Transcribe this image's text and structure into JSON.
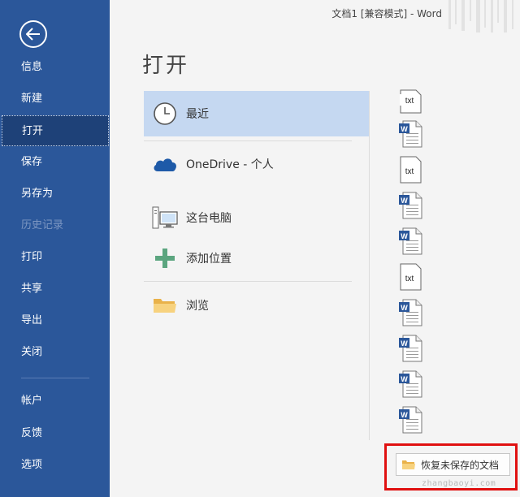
{
  "window": {
    "title": "文档1 [兼容模式]  -  Word"
  },
  "nav": {
    "back_icon": "back-arrow-icon",
    "items": [
      {
        "label": "信息",
        "state": "normal"
      },
      {
        "label": "新建",
        "state": "normal"
      },
      {
        "label": "打开",
        "state": "active"
      },
      {
        "label": "保存",
        "state": "normal"
      },
      {
        "label": "另存为",
        "state": "normal"
      },
      {
        "label": "历史记录",
        "state": "disabled"
      },
      {
        "label": "打印",
        "state": "normal"
      },
      {
        "label": "共享",
        "state": "normal"
      },
      {
        "label": "导出",
        "state": "normal"
      },
      {
        "label": "关闭",
        "state": "normal"
      },
      {
        "label": "帐户",
        "state": "normal"
      },
      {
        "label": "反馈",
        "state": "normal"
      },
      {
        "label": "选项",
        "state": "normal"
      }
    ]
  },
  "main": {
    "title": "打开",
    "locations": [
      {
        "label": "最近",
        "icon": "clock-icon",
        "selected": true
      },
      {
        "label": "OneDrive - 个人",
        "icon": "cloud-icon",
        "selected": false
      },
      {
        "label": "这台电脑",
        "icon": "computer-icon",
        "selected": false
      },
      {
        "label": "添加位置",
        "icon": "plus-icon",
        "selected": false
      },
      {
        "label": "浏览",
        "icon": "folder-icon",
        "selected": false
      }
    ],
    "recent_files": [
      {
        "type": "txt",
        "icon": "text-file-icon",
        "badge": "txt"
      },
      {
        "type": "word",
        "icon": "word-file-icon",
        "badge": "W"
      },
      {
        "type": "txt",
        "icon": "text-file-icon",
        "badge": "txt"
      },
      {
        "type": "word",
        "icon": "word-file-icon",
        "badge": "W"
      },
      {
        "type": "word",
        "icon": "word-file-icon",
        "badge": "W"
      },
      {
        "type": "txt",
        "icon": "text-file-icon",
        "badge": "txt"
      },
      {
        "type": "word",
        "icon": "word-file-icon",
        "badge": "W"
      },
      {
        "type": "word",
        "icon": "word-file-icon",
        "badge": "W"
      },
      {
        "type": "word",
        "icon": "word-file-icon",
        "badge": "W"
      },
      {
        "type": "word",
        "icon": "word-file-icon",
        "badge": "W"
      }
    ],
    "recover_button": {
      "label": "恢复未保存的文档",
      "icon": "folder-icon"
    },
    "watermark": "zhangbaoyi.com"
  },
  "colors": {
    "nav_bg": "#2b579a",
    "nav_active": "#1e4178",
    "selected_location": "#c5d8f1",
    "highlight_box": "#e01010",
    "onedrive_blue": "#1e5aa8",
    "plus_green": "#5ba57f",
    "folder_yellow": "#f3c15a"
  }
}
